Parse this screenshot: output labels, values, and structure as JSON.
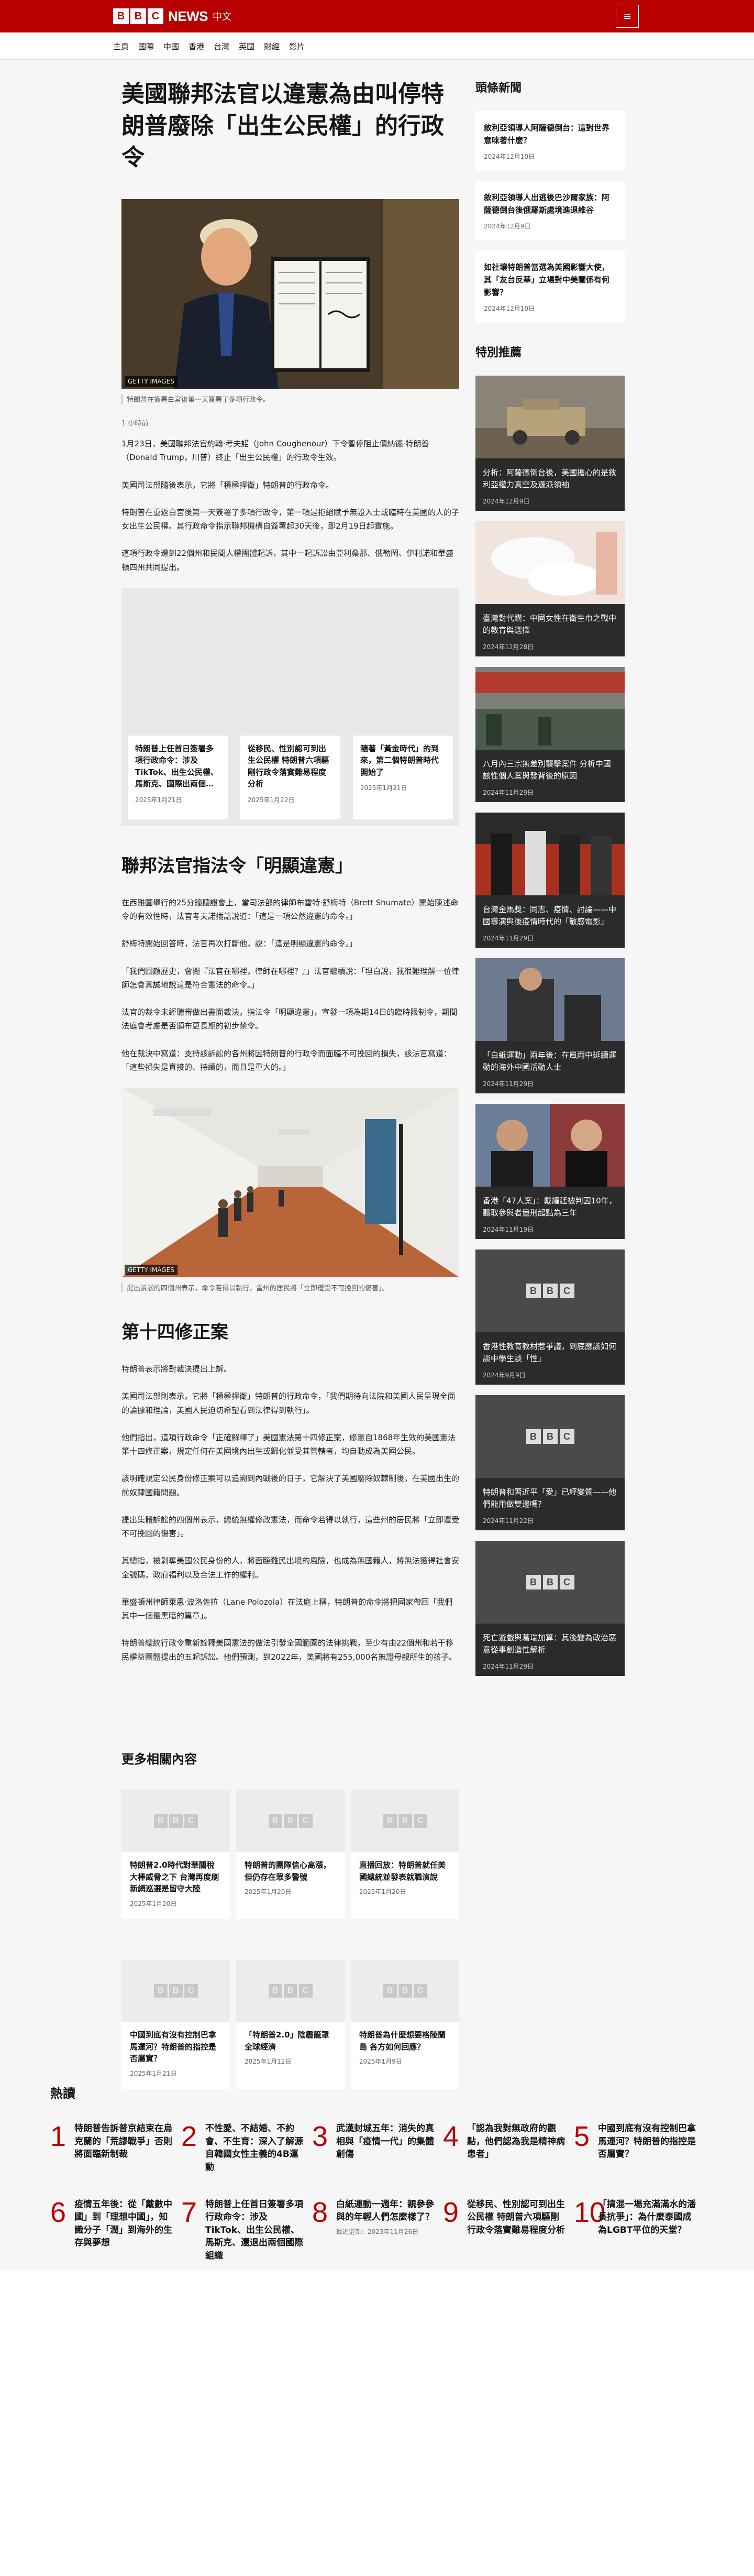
{
  "header": {
    "brand": "NEWS",
    "lang": "中文",
    "blocks": [
      "B",
      "B",
      "C"
    ],
    "menu_icon": "menu-icon"
  },
  "nav": [
    "主頁",
    "國際",
    "中國",
    "香港",
    "台灣",
    "英國",
    "財經",
    "影片"
  ],
  "article": {
    "title": "美國聯邦法官以違憲為由叫停特朗普廢除「出生公民權」的行政令",
    "image_label": "GETTY IMAGES",
    "caption": "特朗普在簽署白宮後第一天簽署了多項行政令。",
    "time": "1 小時前",
    "paragraphs": [
      "1月23日，美國聯邦法官約翰·考夫諾（John Coughenour）下令暫停阻止債納德·特朗普（Donald Trump，川普）終止「出生公民權」的行政令生效。",
      "美國司法部隨後表示，它將「積極捍衛」特朗普的行政命令。",
      "特朗普在重返白宮後第一天簽署了多項行政令，第一項是拒絕賦予無證入士或臨時在美國的人的子女出生公民權。其行政命令指示聯邦機構自簽署起30天後，即2月19日起實施。",
      "這項行政令遭到22個州和民間人權團體起訴，其中一起訴訟由亞利桑那、俄勒岡、伊利諾和華盛頓四州共同提出。"
    ],
    "related": [
      {
        "title": "特朗普上任首日簽署多項行政命令：涉及TikTok、出生公民權、馬斯克、國際出兩個…",
        "date": "2025年1月21日"
      },
      {
        "title": "從移民、性別認可到出生公民權 特朗普六項驅剛行政令落實難易程度分析",
        "date": "2025年1月22日"
      },
      {
        "title": "隨著「黃金時代」的到來，第二個特朗普時代開始了",
        "date": "2025年1月21日"
      }
    ],
    "subheading1": "聯邦法官指法令「明顯違憲」",
    "paragraphs2": [
      "在西雅圖舉行的25分鐘聽證會上，當司法部的律師布雷特·舒梅特（Brett Shumate）開始陳述命令的有效性時，法官考夫諾插話說道：「這是一項公然違憲的命令。」",
      "舒梅特開始回答時，法官再次打斷他，說：「這是明顯違憲的命令。」",
      "「我們回顧歷史，會問『法官在哪裡，律師在哪裡？』」法官繼續說：「坦白說，我很難理解一位律師怎會真誠地說這是符合憲法的命令。」",
      "法官的裁令未經聽審做出書面裁決，指法令「明顯違憲」，宣發一項為期14日的臨時限制令，期間法庭會考慮是否頒布更長期的初步禁令。",
      "他在裁決中寫道：支持該訴訟的各州將因特朗普的行政令而面臨不可挽回的損失，該法官寫道：「這些損失是直接的、持續的，而且是重大的。」"
    ],
    "image2_label": "GETTY IMAGES",
    "caption2": "提出訴訟的四個州表示，命令若得以執行，當州的居民將「立即遭受不可挽回的傷害」。",
    "subheading2": "第十四修正案",
    "paragraphs3": [
      "特朗普表示將對裁決提出上訴。",
      "美國司法部則表示，它將「積極捍衛」特朗普的行政命令，「我們期待向法院和美國人民呈現全面的論據和理論，美國人民迫切希望看到法律得到執行」。",
      "他們指出，這項行政命令「正確解釋了」美國憲法第十四修正案，修憲自1868年生效的美國憲法第十四修正案，規定任何在美國境內出生或歸化並受其管轄者，均自動成為美國公民。",
      "該明確規定公民身份修正案可以追溯到內戰後的日子，它解決了美國廢除奴隸制後，在美國出生的前奴隸國籍問題。",
      "提出集體訴訟的四個州表示，總統無權修改憲法，而命令若得以執行，這些州的居民將「立即遭受不可挽回的傷害」。",
      "其總指，被剝奪美國公民身份的人，將面臨難民出境的風險，也成為無國籍人，將無法獲得社會安全號碼，政府福利以及合法工作的權利。",
      "華盛頓州律師萊恩·波洛佐拉（Lane Polozola）在法庭上稱，特朗普的命令將把國家帶回「我們其中一個最黑暗的篇章」。",
      "特朗普總統行政令重新詮釋美國憲法的做法引發全國範圍的法律挑戰，至少有由22個州和若干移民權益團體提出的五起訴訟。他們預測，到2022年，美國將有255,000名無證母親所生的孩子。"
    ]
  },
  "sidebar": {
    "top_heading": "頭條新聞",
    "top": [
      {
        "title": "敘利亞領導人阿薩德倒台：這對世界意味著什麼？",
        "date": "2024年12月10日"
      },
      {
        "title": "敘利亞領導人出逃後巴沙爾家族：阿薩德倒台後俄羅斯處境進退維谷",
        "date": "2024年12月9日"
      },
      {
        "title": "如社壤特朗普當選為美國影響大使，其「友台反華」立場對中美關係有何影響？",
        "date": "2024年12月10日"
      }
    ],
    "feat_heading": "特別推薦",
    "featured": [
      {
        "title": "分析：阿薩德倒台後，美國擔心的是敘利亞權力真空及遜派領袖",
        "date": "2024年12月9日"
      },
      {
        "title": "臺灣對代購：中國女性在衛生巾之戰中的教育與選擇",
        "date": "2024年12月28日"
      },
      {
        "title": "八月內三宗無差別襲擊案件 分析中國該性個人案與發背後的原因",
        "date": "2024年11月29日"
      },
      {
        "title": "台灣金馬獎：同志、疫情、討論——中國導演與後疫情時代的「敏感電影」",
        "date": "2024年11月29日"
      },
      {
        "title": "「白紙運動」兩年後：在風雨中延續運動的海外中國活動人士",
        "date": "2024年11月29日"
      },
      {
        "title": "香港「47人案」：戴耀廷被判囚10年，聽取參與者量刑起點為三年",
        "date": "2024年11月19日"
      },
      {
        "title": "香港性教育教材惹爭議，到底應該如何談中學生談「性」",
        "date": "2024年9月9日"
      },
      {
        "title": "特朗普和習近平「愛」已經變質——他們能用做雙邊嗎？",
        "date": "2024年11月22日"
      },
      {
        "title": "死亡遊戲與葛瑞加算：其後變為政治惡意從事創造性解析",
        "date": "2024年11月29日"
      }
    ]
  },
  "more": {
    "heading": "更多相關內容",
    "items": [
      {
        "title": "特朗普2.0時代對華關稅大棒威脅之下 台灣再度刷新網巡選是留守大陸",
        "date": "2025年1月20日"
      },
      {
        "title": "特朗普的團隊信心高漲，但仍存在眾多警號",
        "date": "2025年1月20日"
      },
      {
        "title": "直播回放：特朗普就任美國總統並發表就職演說",
        "date": "2025年1月20日"
      },
      {
        "title": "中國到底有沒有控制巴拿馬運河？特朗普的指控是否屬實？",
        "date": "2025年1月21日"
      },
      {
        "title": "「特朗普2.0」陰霾籠罩全球經濟",
        "date": "2025年1月12日"
      },
      {
        "title": "特朗普為什麼想要格陵蘭島 各方如何回應？",
        "date": "2025年1月9日"
      }
    ]
  },
  "popular": {
    "heading": "熱讀",
    "items": [
      {
        "n": "1",
        "title": "特朗普告訴普京結束在烏克蘭的「荒謬戰爭」否則將面臨新制裁"
      },
      {
        "n": "2",
        "title": "不性愛、不結婚、不約會、不生育：深入了解源自韓國女性主義的4B運動"
      },
      {
        "n": "3",
        "title": "武漢封城五年：消失的真相與「疫情一代」的集體創傷"
      },
      {
        "n": "4",
        "title": "「認為我對無政府的觀點，他們認為我是精神病患者」"
      },
      {
        "n": "5",
        "title": "中國到底有沒有控制巴拿馬運河？特朗普的指控是否屬實？"
      },
      {
        "n": "6",
        "title": "疫情五年後：從「戴數中國」到「理想中國」，知識分子「潤」到海外的生存與夢想"
      },
      {
        "n": "7",
        "title": "特朗普上任首日簽署多項行政命令：涉及TikTok、出生公民權、馬斯克、還退出兩個國際組織"
      },
      {
        "n": "8",
        "title": "白紙運動一週年：親參參與的年輕人們怎麼樣了？",
        "date": "最近更新：2023年11月26日"
      },
      {
        "n": "9",
        "title": "從移民、性別認可到出生公民權 特朗普六項驅剛行政令落實難易程度分析"
      },
      {
        "n": "10",
        "title": "「搞混一場充滿滿水的潘長抗爭」：為什麼泰國成為LGBT平位的天堂？"
      }
    ]
  },
  "colors": {
    "brand": "#b80000",
    "page_bg": "#f6f6f6"
  }
}
